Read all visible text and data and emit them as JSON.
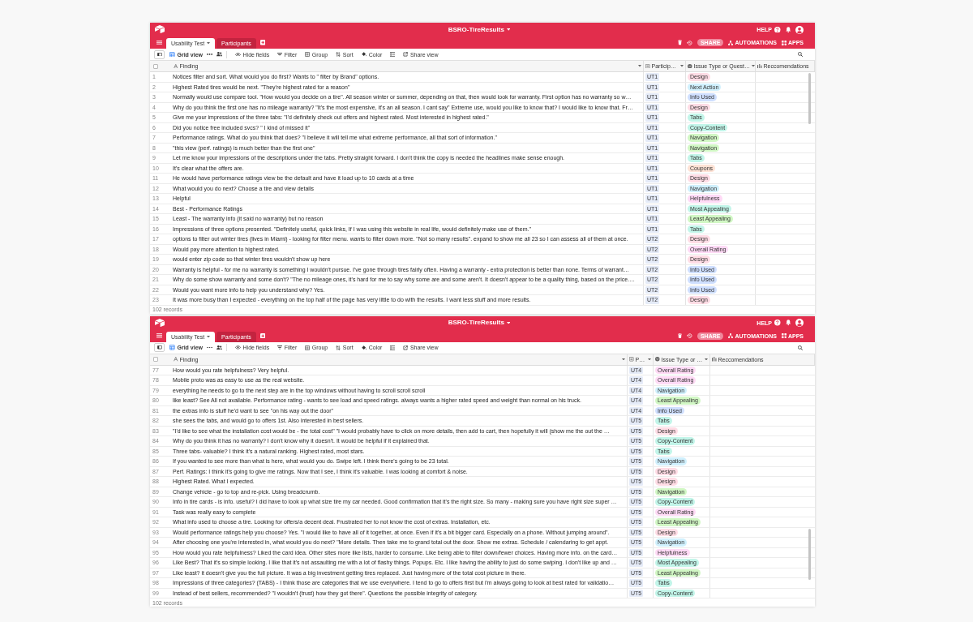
{
  "windows": [
    {
      "title": "BSRO-TireResults",
      "help": "HELP",
      "tabs": [
        {
          "label": "Usability Test",
          "selected": true
        },
        {
          "label": "Participants",
          "selected": false
        }
      ],
      "share": "SHARE",
      "automations": "AUTOMATIONS",
      "apps": "APPS",
      "view": "Grid view",
      "toolbar": [
        {
          "kind": "hide",
          "label": "Hide fields"
        },
        {
          "kind": "filter",
          "label": "Filter"
        },
        {
          "kind": "group",
          "label": "Group"
        },
        {
          "kind": "sort",
          "label": "Sort"
        },
        {
          "kind": "color",
          "label": "Color"
        },
        {
          "kind": "height"
        },
        {
          "kind": "share",
          "label": "Share view"
        }
      ],
      "select_all": {
        "checked": false
      },
      "columns": [
        {
          "kind": "text",
          "label": "Finding"
        },
        {
          "kind": "link",
          "label": "Particip…"
        },
        {
          "kind": "select",
          "label": "Issue Type or Quest…"
        },
        {
          "kind": "multi",
          "label": "Reccomendations"
        }
      ],
      "rows": [
        {
          "number": "1",
          "finding": "Notices filter and sort. What would you do first? Wants to \" filter by Brand\" options.",
          "participant": "UT1",
          "tag": {
            "label": "Design",
            "color": "#ffdce5"
          }
        },
        {
          "number": "2",
          "finding": "Highest Rated tires would be next. \"They're highest rated for a reason\"",
          "participant": "UT1",
          "tag": {
            "label": "Next Action",
            "color": "#d0f0fd"
          }
        },
        {
          "number": "3",
          "finding": "Normally would use compare tool. \"How would you decide on a tire\". All season winter or summer, depending on that, then would look for warranty. First option has no warranty so w…",
          "participant": "UT1",
          "tag": {
            "label": "Info Used",
            "color": "#cfdfff"
          }
        },
        {
          "number": "4",
          "finding": "Why do you think the first one has no mileage warranty? \"It's the most expensive, it's an all season. I cant say\" Extreme use, would you like to know that? I would like to know that. Fr…",
          "participant": "UT1",
          "tag": {
            "label": "Design",
            "color": "#ffdce5"
          }
        },
        {
          "number": "5",
          "finding": "Give me your impressions of the three tabs: \"I'd definitely check out offers and highest rated. Most interested in highest rated.\"",
          "participant": "UT1",
          "tag": {
            "label": "Tabs",
            "color": "#c2f5e9"
          }
        },
        {
          "number": "6",
          "finding": "Did you notice free included svcs? \" I kind of missed it\"",
          "participant": "UT1",
          "tag": {
            "label": "Copy-Content",
            "color": "#c2f5e9"
          }
        },
        {
          "number": "7",
          "finding": "Performance ratings. What do you think that does? \"I believe it will tell me what extreme performance, all that sort of information.\"",
          "participant": "UT1",
          "tag": {
            "label": "Navigation",
            "color": "#d1f7c4"
          }
        },
        {
          "number": "8",
          "finding": "\"this view (perf. ratings) is much better than the first one\"",
          "participant": "UT1",
          "tag": {
            "label": "Navigation",
            "color": "#d1f7c4"
          }
        },
        {
          "number": "9",
          "finding": "Let me know your impressions of the descriptions under the tabs. Pretty straight forward. I don't think the copy is needed the headlines make sense enough.",
          "participant": "UT1",
          "tag": {
            "label": "Tabs",
            "color": "#c2f5e9"
          }
        },
        {
          "number": "10",
          "finding": "It's clear what the offers are.",
          "participant": "UT1",
          "tag": {
            "label": "Coupons",
            "color": "#fee2d5"
          }
        },
        {
          "number": "11",
          "finding": "He would have performance ratings view be the default and have it load up to 10 cards at a time",
          "participant": "UT1",
          "tag": {
            "label": "Design",
            "color": "#ffdce5"
          }
        },
        {
          "number": "12",
          "finding": "What would you do next? Choose a tire and view details",
          "participant": "UT1",
          "tag": {
            "label": "Navigation",
            "color": "#d0f0fd"
          }
        },
        {
          "number": "13",
          "finding": "Helpful",
          "participant": "UT1",
          "tag": {
            "label": "Helpfulness",
            "color": "#ffdaf6"
          }
        },
        {
          "number": "14",
          "finding": "Best - Performance Ratings",
          "participant": "UT1",
          "tag": {
            "label": "Most Appealing",
            "color": "#c2f5e9"
          }
        },
        {
          "number": "15",
          "finding": "Least - The warranty info (it said no warranty) but no reason",
          "participant": "UT1",
          "tag": {
            "label": "Least Appealing",
            "color": "#d1f7c4"
          }
        },
        {
          "number": "16",
          "finding": "Impressions of three options presented. \"Definitely useful, quick links, If I was using this website in real life, would definitely make use of them.\"",
          "participant": "UT1",
          "tag": {
            "label": "Tabs",
            "color": "#c2f5e9"
          }
        },
        {
          "number": "17",
          "finding": "options to filter out winter tires (lives in Miami) - looking for filter menu. wants to filter down more. \"Not so many results\". expand to show me all 23 so I can assess all of them at once.",
          "participant": "UT2",
          "tag": {
            "label": "Design",
            "color": "#ffdce5"
          }
        },
        {
          "number": "18",
          "finding": "Would pay more attention to highest rated.",
          "participant": "UT2",
          "tag": {
            "label": "Overall Rating",
            "color": "#ffdaf6"
          }
        },
        {
          "number": "19",
          "finding": "would enter zip code so that winter tires wouldn't show up here",
          "participant": "UT2",
          "tag": {
            "label": "Design",
            "color": "#ffdce5"
          }
        },
        {
          "number": "20",
          "finding": "Warranty is helpful - for me no warranty is something I wouldn't pursue. I've gone through tires fairly often. Having a warranty - extra protection is better than none. Terms of warrant…",
          "participant": "UT2",
          "tag": {
            "label": "Info Used",
            "color": "#cfdfff"
          }
        },
        {
          "number": "21",
          "finding": "Why do some show warranty and some don't? \"The no mileage ones, it's hard for me to say why some are and some aren't. It doesn't appear to be a quality thing, based on the price.…",
          "participant": "UT2",
          "tag": {
            "label": "Info Used",
            "color": "#cfdfff"
          }
        },
        {
          "number": "22",
          "finding": "Would you want more info to help you understand why? Yes.",
          "participant": "UT2",
          "tag": {
            "label": "Info Used",
            "color": "#cfdfff"
          }
        },
        {
          "number": "23",
          "finding": "It was more busy than I expected - everything on the top half of the page has very little to do with the results. I want less stuff and more results.",
          "participant": "UT2",
          "tag": {
            "label": "Design",
            "color": "#ffdce5"
          }
        }
      ],
      "footer": "102 records"
    },
    {
      "title": "BSRO-TireResults",
      "help": "HELP",
      "tabs": [
        {
          "label": "Usability Test",
          "selected": true
        },
        {
          "label": "Participants",
          "selected": false
        }
      ],
      "share": "SHARE",
      "automations": "AUTOMATIONS",
      "apps": "APPS",
      "view": "Grid view",
      "toolbar": [
        {
          "kind": "hide",
          "label": "Hide fields"
        },
        {
          "kind": "filter",
          "label": "Filter"
        },
        {
          "kind": "group",
          "label": "Group"
        },
        {
          "kind": "sort",
          "label": "Sort"
        },
        {
          "kind": "color",
          "label": "Color"
        },
        {
          "kind": "height"
        },
        {
          "kind": "share",
          "label": "Share view"
        }
      ],
      "select_all": {
        "checked": false
      },
      "columns": [
        {
          "kind": "text",
          "label": "Finding"
        },
        {
          "kind": "link",
          "label": "P…"
        },
        {
          "kind": "select",
          "label": "Issue Type or …"
        },
        {
          "kind": "multi",
          "label": "Reccomendations"
        }
      ],
      "rows": [
        {
          "number": "77",
          "finding": "How would you rate helpfulness? Very helpful.",
          "participant": "UT4",
          "tag": {
            "label": "Overall Rating",
            "color": "#ffdaf6"
          }
        },
        {
          "number": "78",
          "finding": "Mobile proto was as easy to use as the real website.",
          "participant": "UT4",
          "tag": {
            "label": "Overall Rating",
            "color": "#ffdaf6"
          }
        },
        {
          "number": "79",
          "finding": "everything he needs to go to the next step are in the top windows without having to scroll scroll scroll",
          "participant": "UT4",
          "tag": {
            "label": "Navigation",
            "color": "#d0f0fd"
          }
        },
        {
          "number": "80",
          "finding": "like least? See All not available. Performance rating - wants to see load and speed ratings. always wants a higher rated speed and weight than normal on his truck.",
          "participant": "UT4",
          "tag": {
            "label": "Least Appealing",
            "color": "#d1f7c4"
          }
        },
        {
          "number": "81",
          "finding": "the extras info is stuff he'd want to see \"on his way out the door\"",
          "participant": "UT4",
          "tag": {
            "label": "Info Used",
            "color": "#cfdfff"
          }
        },
        {
          "number": "82",
          "finding": "she sees the tabs, and would go to offers 1st. Also interested in best sellers.",
          "participant": "UT5",
          "tag": {
            "label": "Tabs",
            "color": "#c2f5e9"
          }
        },
        {
          "number": "83",
          "finding": "\"I'd like to see what the installation cost would be - the total cost\" \"I would probably have to click on more details, then add to cart, then hopefully it will (show me the out the …",
          "participant": "UT5",
          "tag": {
            "label": "Design",
            "color": "#ffdce5"
          }
        },
        {
          "number": "84",
          "finding": "Why do you think it has no warranty? I don't know why it doesn't. It would be helpful if it explained that.",
          "participant": "UT5",
          "tag": {
            "label": "Copy-Content",
            "color": "#c2f5e9"
          }
        },
        {
          "number": "85",
          "finding": "Three tabs- valuable? I think it's a natural ranking. Highest rated, most stars.",
          "participant": "UT5",
          "tag": {
            "label": "Tabs",
            "color": "#c2f5e9"
          }
        },
        {
          "number": "86",
          "finding": "If you wanted to see more than what is here, what would you do. Swipe left. I think there's going to be 23 total.",
          "participant": "UT5",
          "tag": {
            "label": "Navigation",
            "color": "#d0f0fd"
          }
        },
        {
          "number": "87",
          "finding": "Perf. Ratings: I think it's going to give me ratings. Now that I see, I think it's valuable. I was looking at comfort & noise.",
          "participant": "UT5",
          "tag": {
            "label": "Design",
            "color": "#ffdce5"
          }
        },
        {
          "number": "88",
          "finding": "Highest Rated. What I expected.",
          "participant": "UT5",
          "tag": {
            "label": "Design",
            "color": "#ffdce5"
          }
        },
        {
          "number": "89",
          "finding": "Change vehicle - go to top and re-pick. Using breadcrumb.",
          "participant": "UT5",
          "tag": {
            "label": "Navigation",
            "color": "#d1f7c4"
          }
        },
        {
          "number": "90",
          "finding": "Info in tire cards - is info. useful? I did have to look up what size tire my car needed. Good confirmation that it's the right size. So many - making sure you have right size super …",
          "participant": "UT5",
          "tag": {
            "label": "Copy-Content",
            "color": "#c2f5e9"
          }
        },
        {
          "number": "91",
          "finding": "Task was really easy to complete",
          "participant": "UT5",
          "tag": {
            "label": "Overall Rating",
            "color": "#ffdaf6"
          }
        },
        {
          "number": "92",
          "finding": "What info used to choose a tire. Looking for offers/a decent deal. Frustrated her to not know the cost of extras. Installation, etc.",
          "participant": "UT5",
          "tag": {
            "label": "Least Appealing",
            "color": "#d1f7c4"
          }
        },
        {
          "number": "93",
          "finding": "Would performance ratings help you choose? Yes. \"I would like to have all of it together, at once. Even if it's a bit bigger card. Especially on a phone. Without jumping around\".",
          "participant": "UT5",
          "tag": {
            "label": "Design",
            "color": "#ffdce5"
          }
        },
        {
          "number": "94",
          "finding": "After choosing one you're interested in, what would you do next? \"More details. Then take me to grand total out the door. Show me extras. Schedule / calendaring to get appt.",
          "participant": "UT5",
          "tag": {
            "label": "Navigation",
            "color": "#d0f0fd"
          }
        },
        {
          "number": "95",
          "finding": "How would you rate helpfulness? Liked the card idea. Other sites more like lists, harder to consume. Like being able to filter down/fewer choices. Having more info. on the card…",
          "participant": "UT5",
          "tag": {
            "label": "Helpfulness",
            "color": "#ffdaf6"
          }
        },
        {
          "number": "96",
          "finding": "Like Best? That it's so simple looking. I like that it's not assaulting me with a lot of flashy things. Popups. Etc. I like having the ability to just do some swiping. I don't like up and …",
          "participant": "UT5",
          "tag": {
            "label": "Most Appealing",
            "color": "#c2f5e9"
          }
        },
        {
          "number": "97",
          "finding": "Like least? it doesn't give you the full picture. It was a big investment getting tires replaced. Just having more of the total cost picture in there.",
          "participant": "UT5",
          "tag": {
            "label": "Least Appealing",
            "color": "#d1f7c4"
          }
        },
        {
          "number": "98",
          "finding": "Impressions of three categories? (TABS) - I think those are categories that we use everywhere. I tend to go to offers first but i'm always going to look at best rated for validatio…",
          "participant": "UT5",
          "tag": {
            "label": "Tabs",
            "color": "#c2f5e9"
          }
        },
        {
          "number": "99",
          "finding": "Instead of best sellers, recommended? \"I wouldn't (trust) how they got there\". Questions the possible integrity of category.",
          "participant": "UT5",
          "tag": {
            "label": "Copy-Content",
            "color": "#c2f5e9"
          }
        }
      ],
      "footer": "102 records"
    }
  ]
}
